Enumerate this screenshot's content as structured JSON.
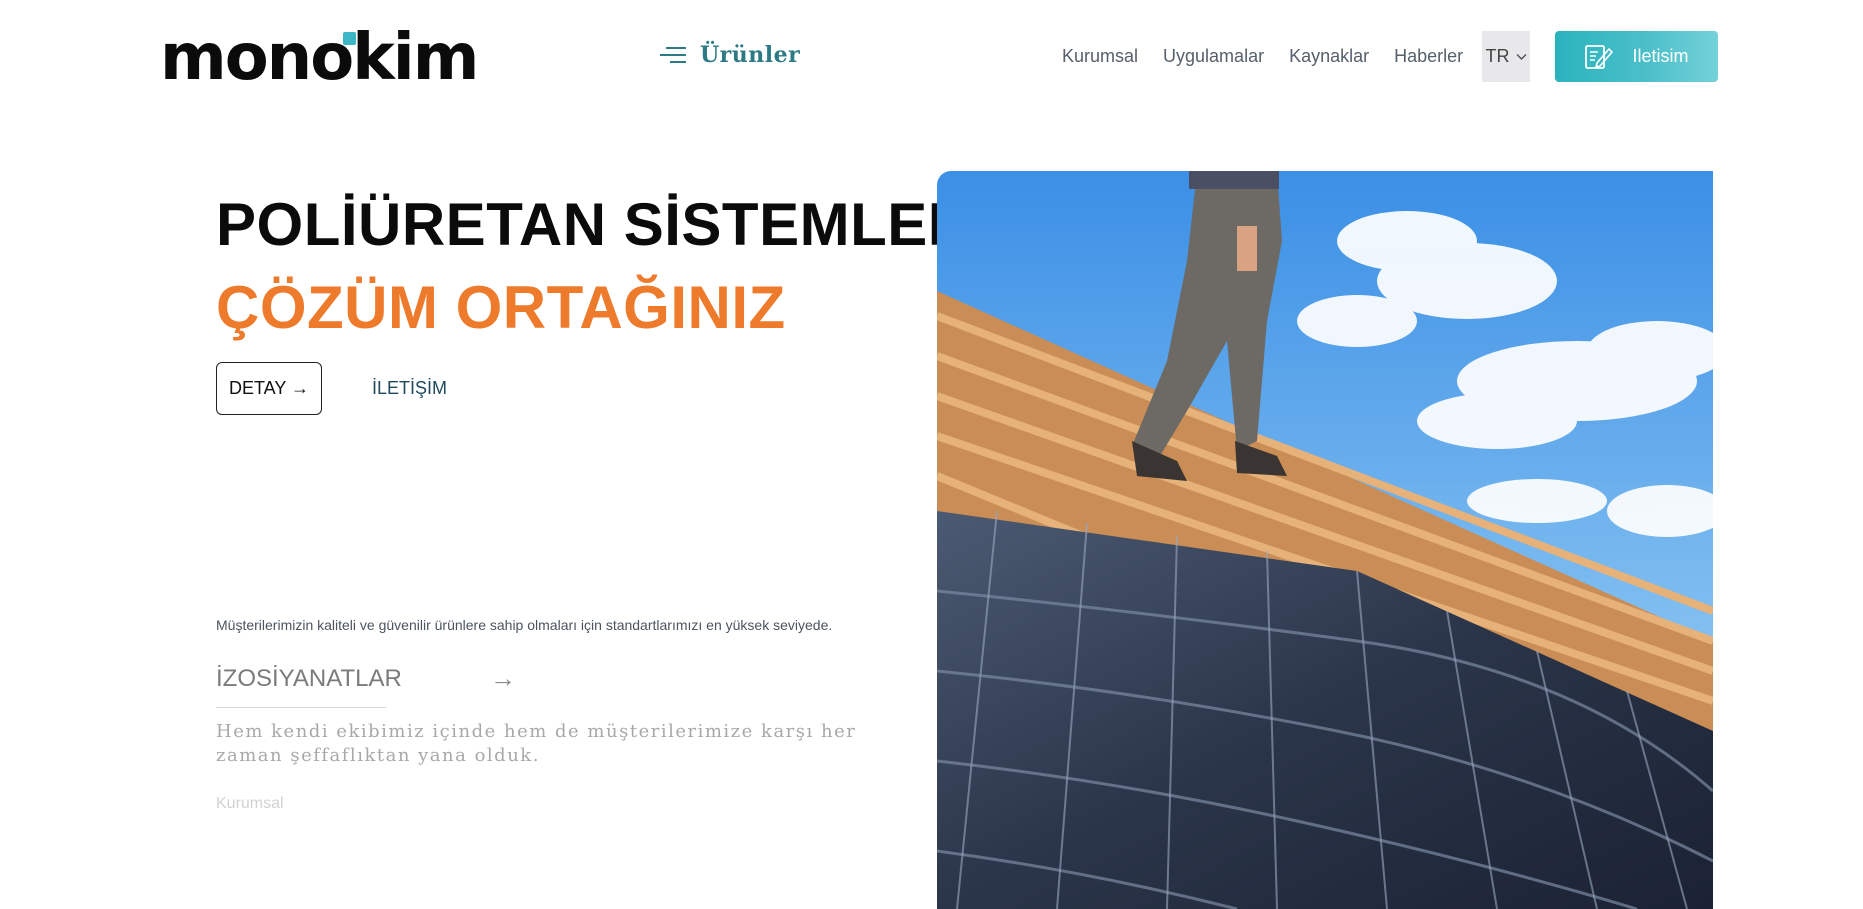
{
  "header": {
    "logo_text": "monokim",
    "products_label": "Ürünler",
    "nav": [
      "Kurumsal",
      "Uygulamalar",
      "Kaynaklar",
      "Haberler"
    ],
    "language": "TR",
    "contact_button_label": "Iletisim"
  },
  "hero": {
    "title": "POLİÜRETAN SİSTEMLER",
    "subtitle": "ÇÖZÜM ORTAĞINIZ",
    "detail_button": "DETAY →",
    "contact_link": "İLETİŞİM"
  },
  "section": {
    "description": "Müşterilerimizin kaliteli ve güvenilir ürünlere sahip olmaları için standartlarımızı en yüksek seviyede.",
    "category_title": "İZOSİYANATLAR",
    "category_arrow": "→",
    "category_text": "Hem kendi ekibimiz içinde hem de müşterilerimize karşı her zaman şeffaflıktan yana olduk.",
    "category_link": "Kurumsal"
  },
  "colors": {
    "accent_teal": "#2ab3bd",
    "accent_orange": "#ee7a2b",
    "nav_text": "#55606b"
  },
  "icons": {
    "menu": "menu-lines-icon",
    "lang_caret": "chevron-down-icon",
    "contact": "edit-document-icon",
    "hero_image": "roof-worker-photo"
  }
}
